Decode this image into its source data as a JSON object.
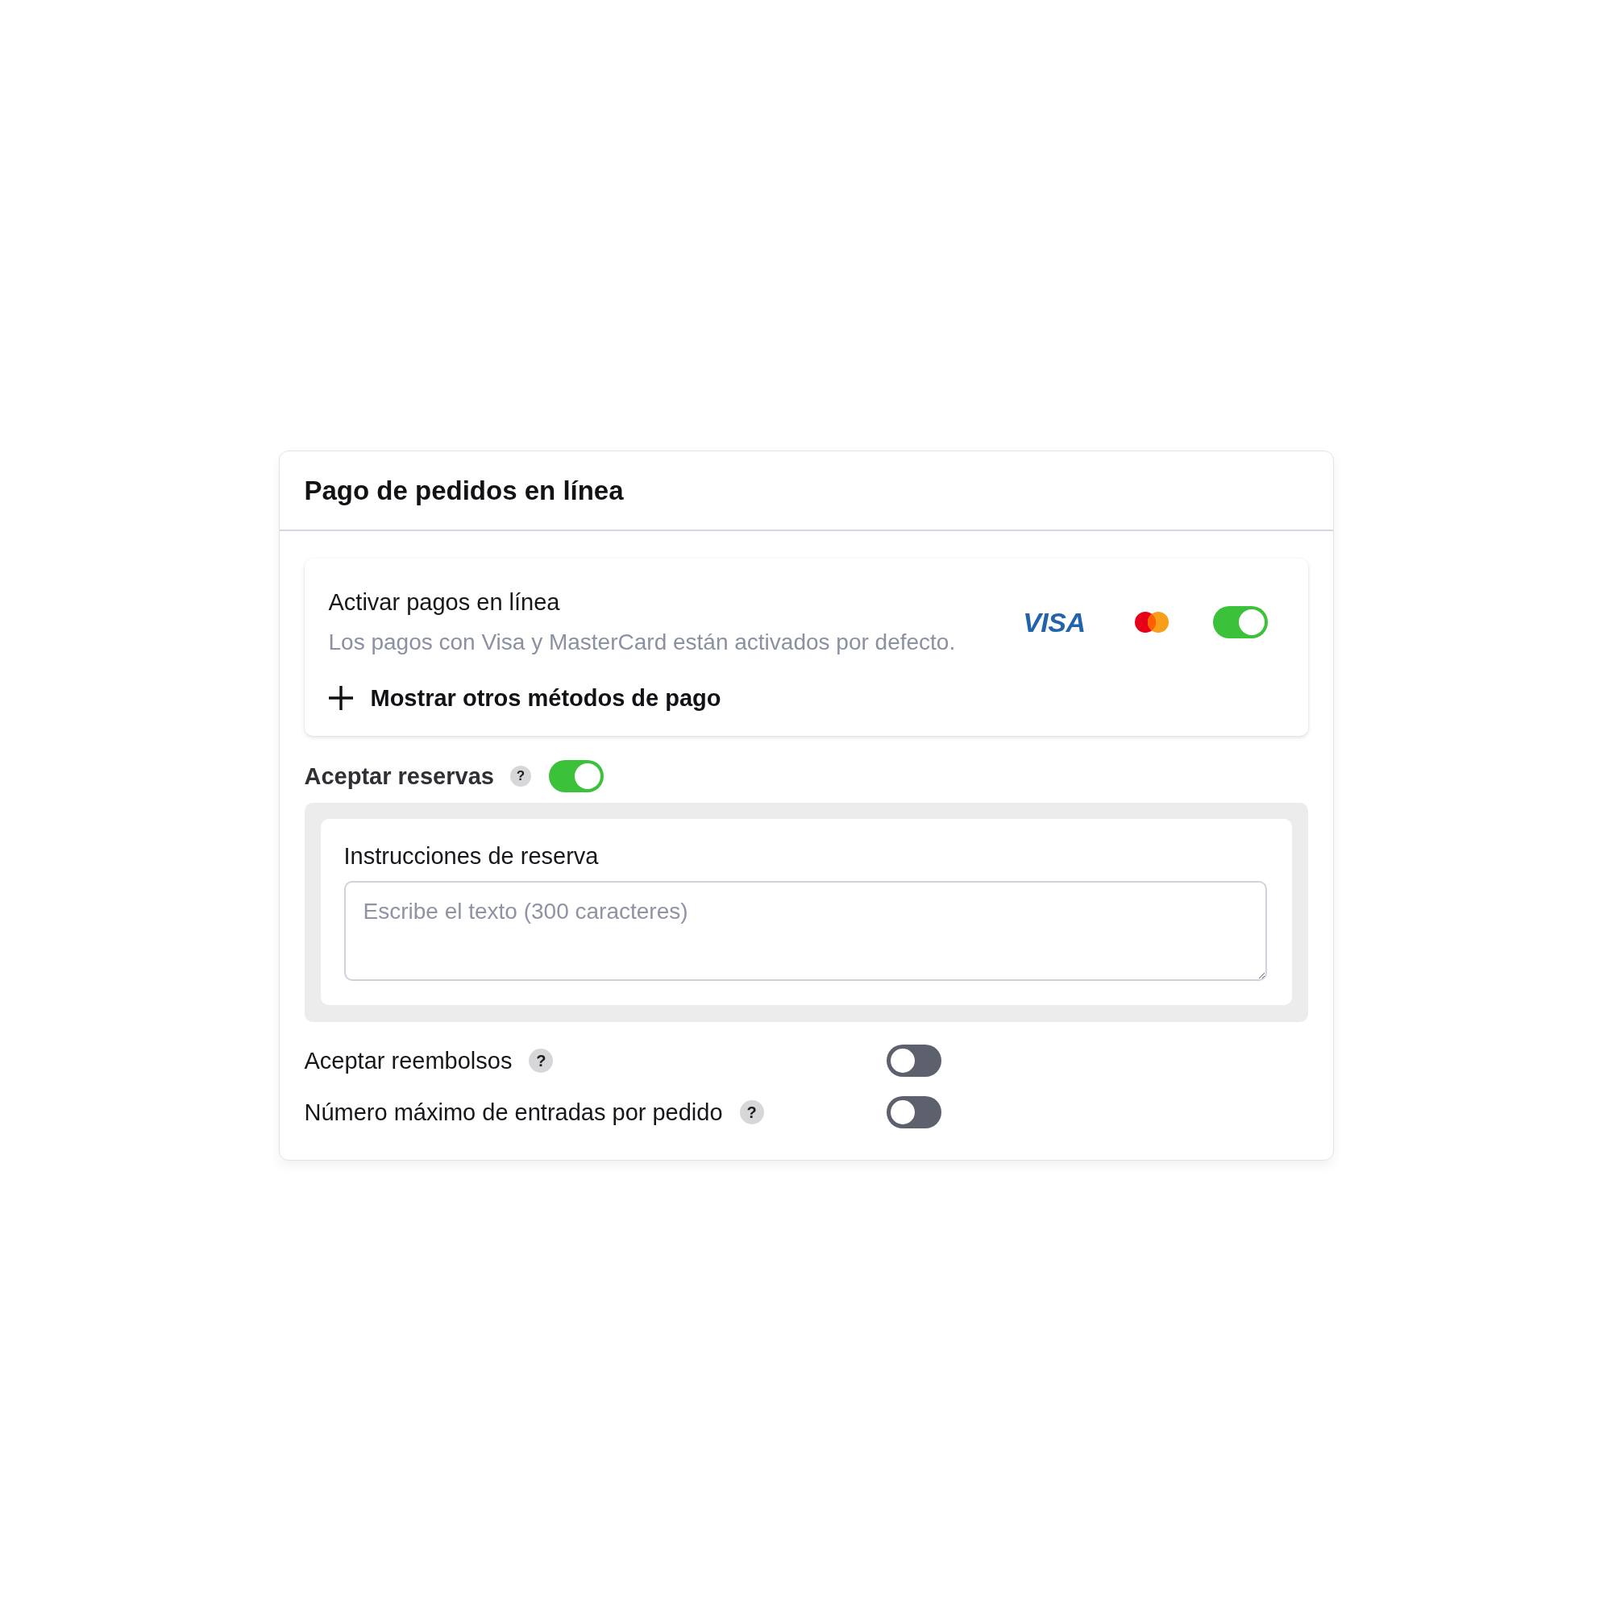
{
  "panel": {
    "title": "Pago de pedidos en línea"
  },
  "online_payments": {
    "label": "Activar pagos en línea",
    "description": "Los pagos con Visa y MasterCard están activados por defecto.",
    "card_logos": [
      {
        "kind": "wordmark",
        "text": "VISA"
      },
      {
        "kind": "circles"
      }
    ],
    "on": true,
    "more_link": "Mostrar otros métodos de pago"
  },
  "reservations": {
    "label": "Aceptar reservas",
    "help": "?",
    "on": true,
    "instructions": {
      "label": "Instrucciones de reserva",
      "placeholder": "Escribe el texto (300 caracteres)"
    }
  },
  "settings": [
    {
      "label": "Aceptar reembolsos",
      "help": "?",
      "on": false
    },
    {
      "label": "Número máximo de entradas por pedido",
      "help": "?",
      "on": false
    }
  ]
}
